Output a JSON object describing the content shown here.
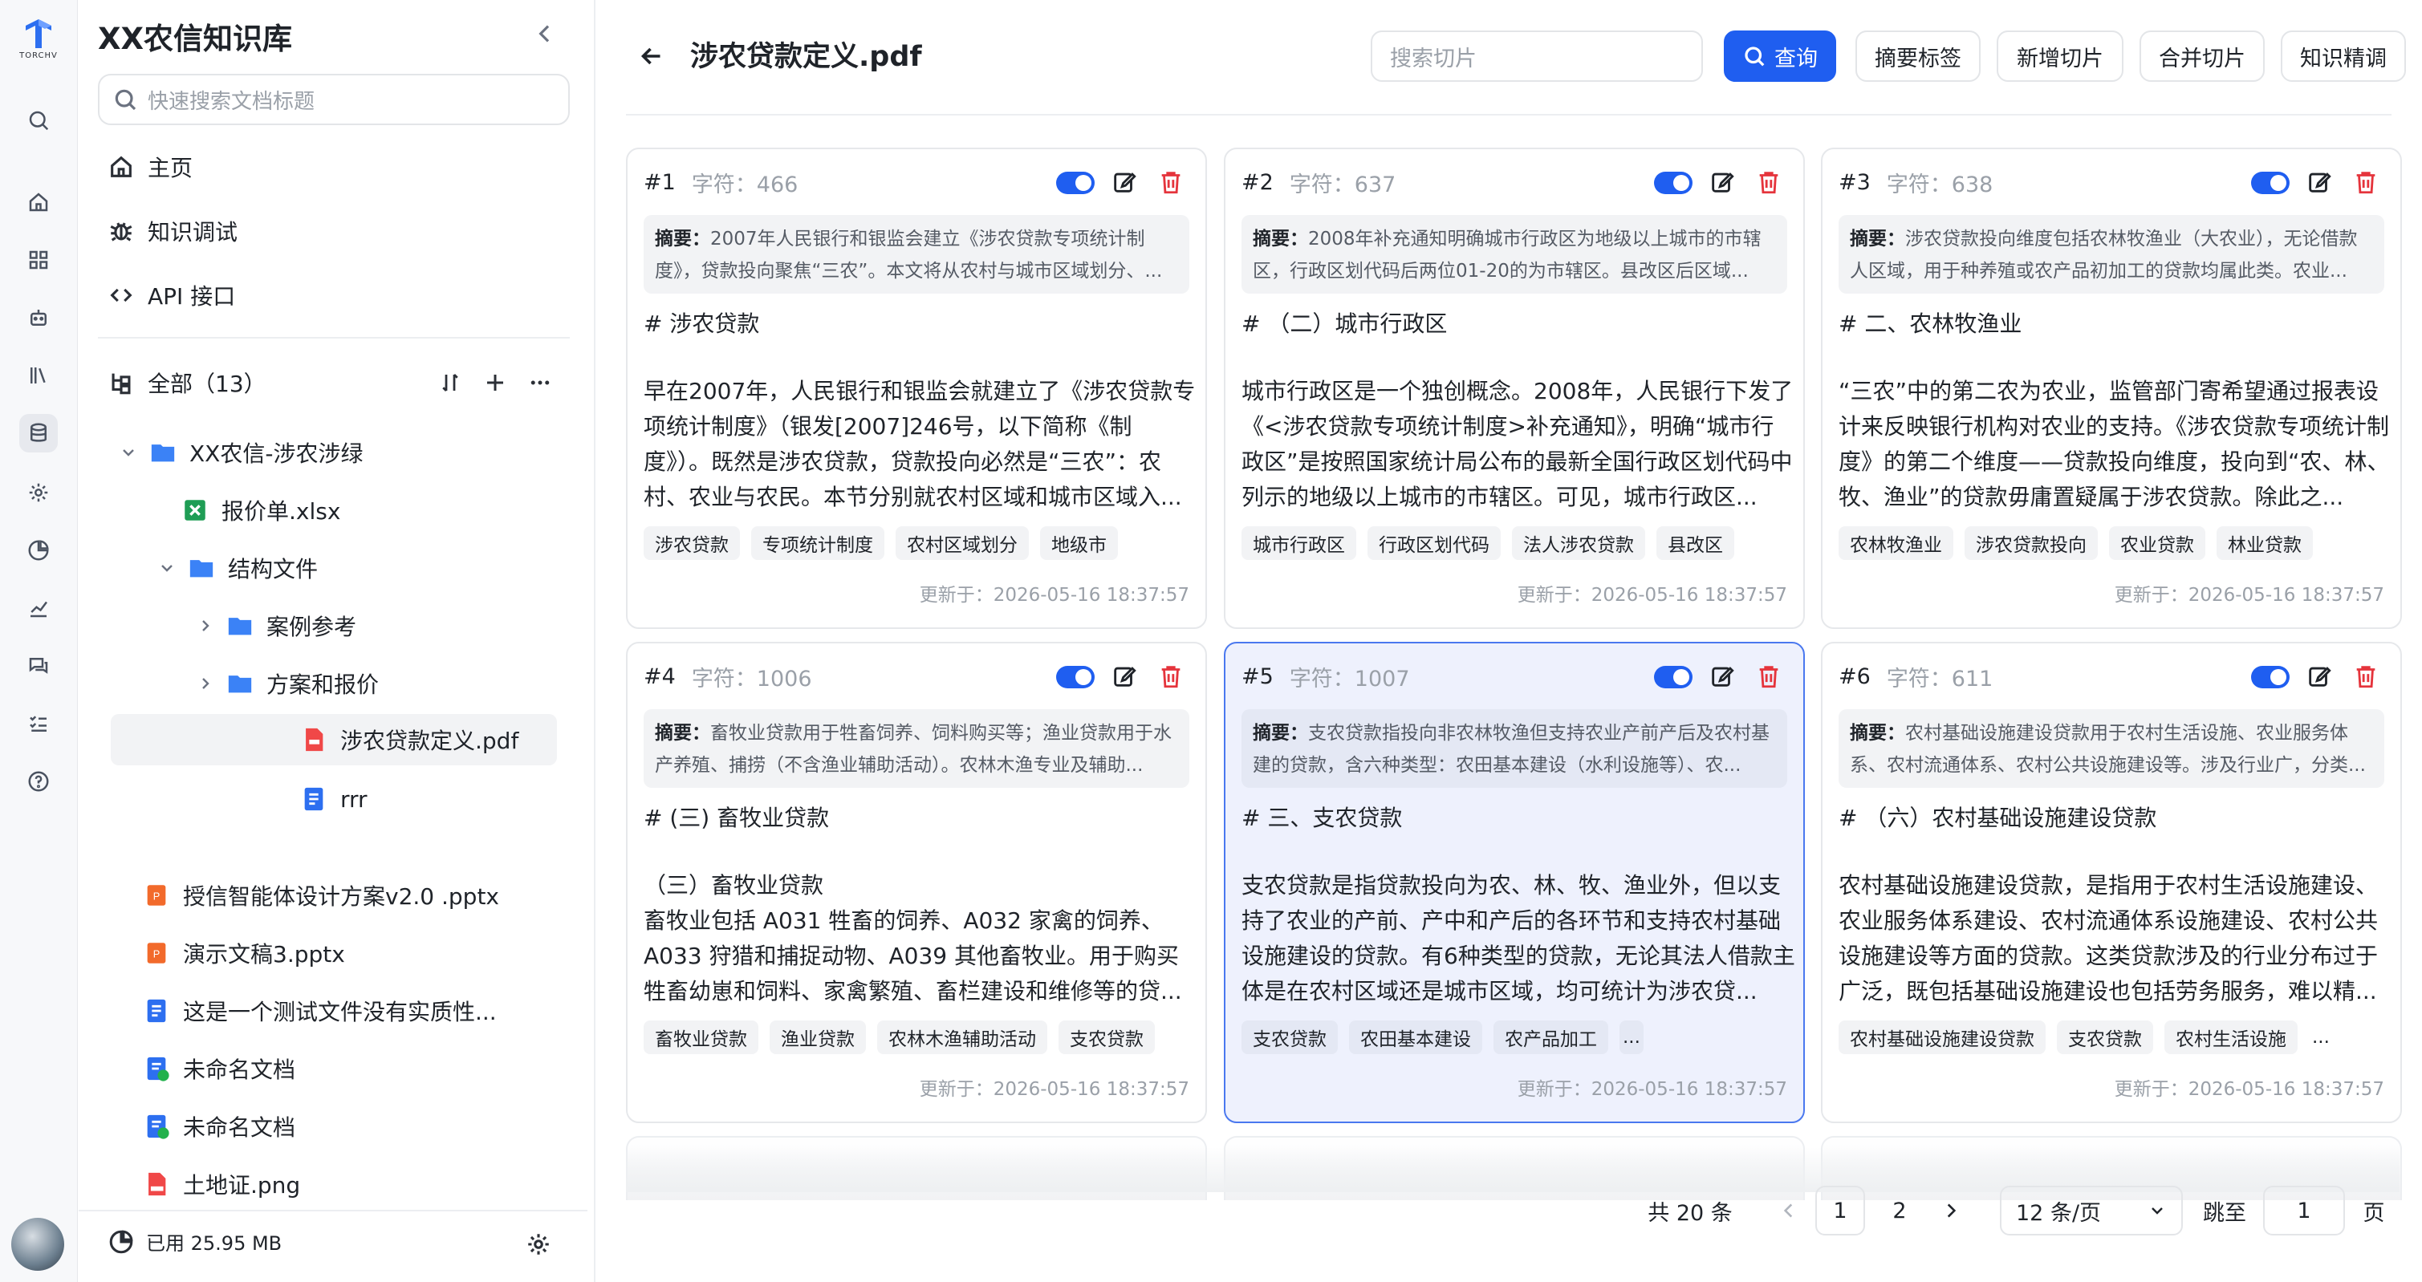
{
  "sidebar": {
    "title": "XX农信知识库",
    "search_placeholder": "快速搜索文档标题",
    "nav": [
      {
        "label": "主页",
        "icon": "home-icon"
      },
      {
        "label": "知识调试",
        "icon": "bug-icon"
      },
      {
        "label": "API 接口",
        "icon": "code-icon"
      }
    ],
    "tree_header": "全部（13）",
    "tree": [
      {
        "label": "XX农信-涉农涉绿",
        "type": "folder",
        "expanded": true
      },
      {
        "label": "报价单.xlsx",
        "type": "excel"
      },
      {
        "label": "结构文件",
        "type": "folder",
        "expanded": true
      },
      {
        "label": "案例参考",
        "type": "folder"
      },
      {
        "label": "方案和报价",
        "type": "folder"
      },
      {
        "label": "涉农贷款定义.pdf",
        "type": "pdf",
        "selected": true
      },
      {
        "label": "rrr",
        "type": "doc"
      },
      {
        "label": "授信智能体设计方案v2.0 .pptx",
        "type": "ppt"
      },
      {
        "label": "演示文稿3.pptx",
        "type": "ppt"
      },
      {
        "label": "这是一个测试文件没有实质性...",
        "type": "doc"
      },
      {
        "label": "未命名文档",
        "type": "doc-ok"
      },
      {
        "label": "未命名文档",
        "type": "doc-ok"
      },
      {
        "label": "土地证.png",
        "type": "png"
      }
    ],
    "storage": "已用 25.95 MB"
  },
  "rail": {
    "logo_text": "TORCHV"
  },
  "header": {
    "title": "涉农贷款定义.pdf",
    "search_placeholder": "搜索切片",
    "query_label": "查询",
    "buttons": [
      "摘要标签",
      "新增切片",
      "合并切片",
      "知识精调"
    ]
  },
  "cards": [
    {
      "index": "#1",
      "chars": "字符：466",
      "summary_label": "摘要：",
      "summary": "2007年人民银行和银监会建立《涉农贷款专项统计制度》，贷款投向聚焦“三农”。本文将从农村与城市区域划分、...",
      "heading": "# 涉农贷款",
      "body": "早在2007年，人民银行和银监会就建立了《涉农贷款专项统计制度》（银发[2007]246号，以下简称《制度》）。既然是涉农贷款，贷款投向必然是“三农”：农村、农业与农民。本节分别就农村区域和城市区域入...",
      "tags": [
        "涉农贷款",
        "专项统计制度",
        "农村区域划分",
        "地级市"
      ],
      "updated": "更新于：2026-05-16 18:37:57",
      "enabled": true
    },
    {
      "index": "#2",
      "chars": "字符：637",
      "summary_label": "摘要：",
      "summary": "2008年补充通知明确城市行政区为地级以上城市的市辖区，行政区划代码后两位01-20的为市辖区。县改区后区域...",
      "heading": "# （二）城市行政区",
      "body": "城市行政区是一个独创概念。2008年，人民银行下发了《<涉农贷款专项统计制度>补充通知》，明确“城市行政区”是按照国家统计局公布的最新全国行政区划代码中列示的地级以上城市的市辖区。可见，城市行政区...",
      "tags": [
        "城市行政区",
        "行政区划代码",
        "法人涉农贷款",
        "县改区"
      ],
      "updated": "更新于：2026-05-16 18:37:57",
      "enabled": true
    },
    {
      "index": "#3",
      "chars": "字符：638",
      "summary_label": "摘要：",
      "summary": "涉农贷款投向维度包括农林牧渔业（大农业），无论借款人区域，用于种养殖或农产品初加工的贷款均属此类。农业...",
      "heading": "# 二、农林牧渔业",
      "body": "“三农”中的第二农为农业，监管部门寄希望通过报表设计来反映银行机构对农业的支持。《涉农贷款专项统计制度》的第二个维度——贷款投向维度，投向到“农、林、牧、渔业”的贷款毋庸置疑属于涉农贷款。除此之...",
      "tags": [
        "农林牧渔业",
        "涉农贷款投向",
        "农业贷款",
        "林业贷款"
      ],
      "updated": "更新于：2026-05-16 18:37:57",
      "enabled": true
    },
    {
      "index": "#4",
      "chars": "字符：1006",
      "summary_label": "摘要：",
      "summary": "畜牧业贷款用于牲畜饲养、饲料购买等；渔业贷款用于水产养殖、捕捞（不含渔业辅助活动）。农林木渔专业及辅助...",
      "heading": "# (三) 畜牧业贷款",
      "body": "（三）畜牧业贷款\n畜牧业包括 A031 牲畜的饲养、A032 家禽的饲养、A033 狩猎和捕捉动物、A039 其他畜牧业。用于购买牲畜幼崽和饲料、家禽繁殖、畜栏建设和维修等的贷...",
      "tags": [
        "畜牧业贷款",
        "渔业贷款",
        "农林木渔辅助活动",
        "支农贷款"
      ],
      "updated": "更新于：2026-05-16 18:37:57",
      "enabled": true
    },
    {
      "index": "#5",
      "chars": "字符：1007",
      "summary_label": "摘要：",
      "summary": "支农贷款指投向非农林牧渔但支持农业产前产后及农村基建的贷款，含六种类型：农田基本建设（水利设施等）、农...",
      "heading": "# 三、支农贷款",
      "body": "支农贷款是指贷款投向为农、林、牧、渔业外，但以支持了农业的产前、产中和产后的各环节和支持农村基础设施建设的贷款。有6种类型的贷款，无论其法人借款主体是在农村区域还是城市区域，均可统计为涉农贷...",
      "tags": [
        "支农贷款",
        "农田基本建设",
        "农产品加工"
      ],
      "more": "...",
      "updated": "更新于：2026-05-16 18:37:57",
      "enabled": true,
      "highlighted": true
    },
    {
      "index": "#6",
      "chars": "字符：611",
      "summary_label": "摘要：",
      "summary": "农村基础设施建设贷款用于农村生活设施、农业服务体系、农村流通体系、农村公共设施建设等。涉及行业广，分类...",
      "heading": "# （六）农村基础设施建设贷款",
      "body": "农村基础设施建设贷款，是指用于农村生活设施建设、农业服务体系建设、农村流通体系设施建设、农村公共设施建设等方面的贷款。这类贷款涉及的行业分布过于广泛，既包括基础设施建设也包括劳务服务，难以精...",
      "tags": [
        "农村基础设施建设贷款",
        "支农贷款",
        "农村生活设施"
      ],
      "more": "...",
      "updated": "更新于：2026-05-16 18:37:57",
      "enabled": true
    }
  ],
  "pagination": {
    "total": "共 20 条",
    "pages": [
      "1",
      "2"
    ],
    "current": "1",
    "page_size": "12 条/页",
    "jump_label": "跳至",
    "jump_value": "1",
    "page_suffix": "页"
  },
  "colors": {
    "primary": "#1f5ef0",
    "danger": "#e5343c",
    "highlight_bg": "#eef1fd"
  }
}
